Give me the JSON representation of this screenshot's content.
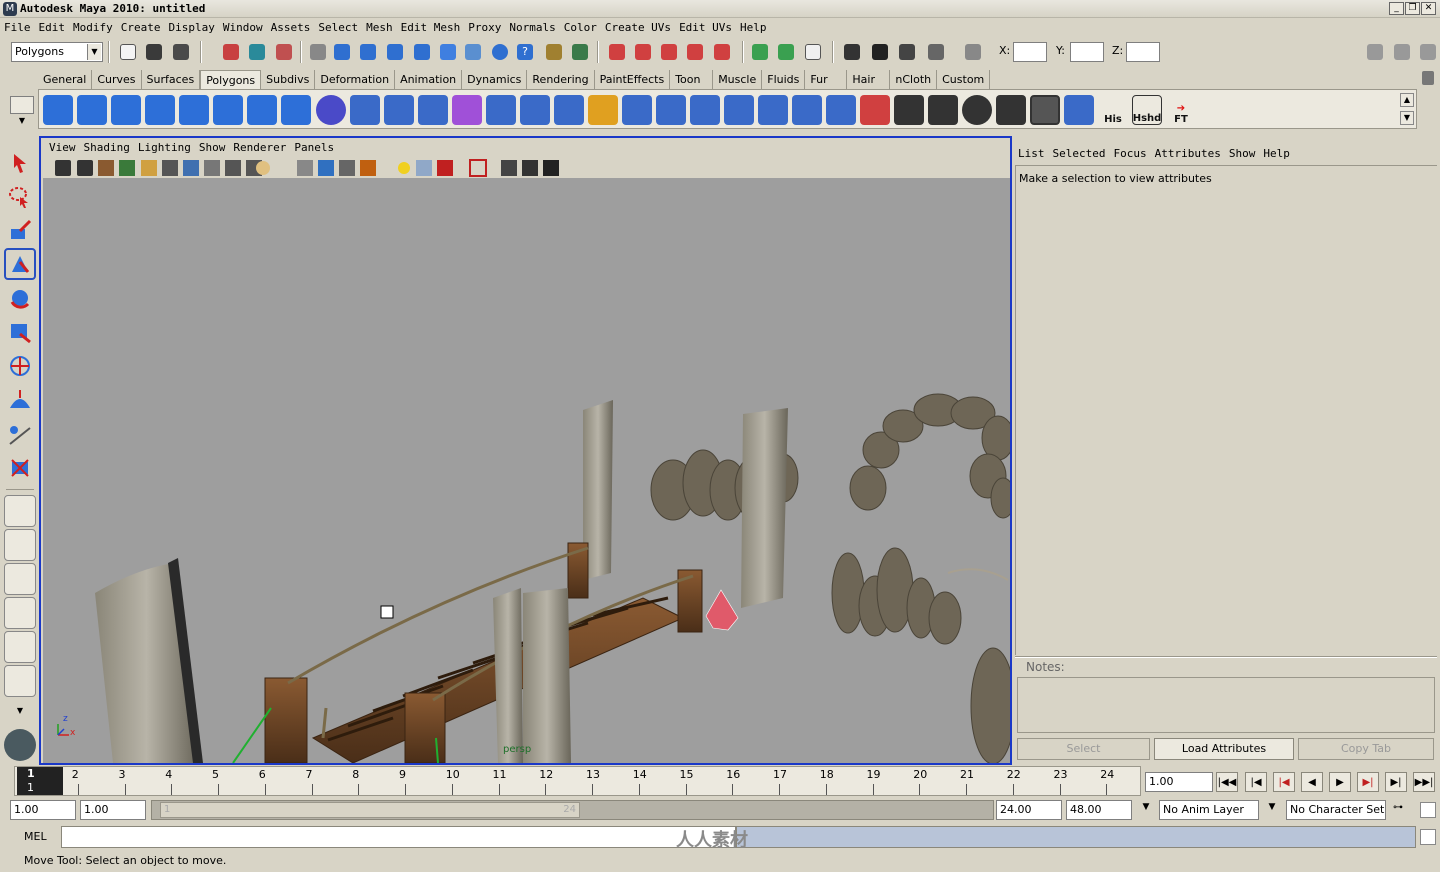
{
  "window": {
    "title": "Autodesk Maya 2010: untitled",
    "icon": "maya-icon",
    "controls": [
      "minimize-icon",
      "restore-icon",
      "close-icon"
    ]
  },
  "menubar": [
    "File",
    "Edit",
    "Modify",
    "Create",
    "Display",
    "Window",
    "Assets",
    "Select",
    "Mesh",
    "Edit Mesh",
    "Proxy",
    "Normals",
    "Color",
    "Create UVs",
    "Edit UVs",
    "Help"
  ],
  "statusline": {
    "menu_set": "Polygons",
    "x_label": "X:",
    "y_label": "Y:",
    "z_label": "Z:",
    "x_value": "",
    "y_value": "",
    "z_value": ""
  },
  "shelf": {
    "tabs": [
      "General",
      "Curves",
      "Surfaces",
      "Polygons",
      "Subdivs",
      "Deformation",
      "Animation",
      "Dynamics",
      "Rendering",
      "PaintEffects",
      "Toon",
      "Muscle",
      "Fluids",
      "Fur",
      "Hair",
      "nCloth",
      "Custom"
    ],
    "active_tab": "Polygons",
    "text_buttons": {
      "his": "His",
      "hshd": "Hshd",
      "ft": "FT"
    }
  },
  "viewport": {
    "menu": [
      "View",
      "Shading",
      "Lighting",
      "Show",
      "Renderer",
      "Panels"
    ],
    "camera_label": "persp",
    "axis_x": "x",
    "axis_z": "z"
  },
  "attribute_editor": {
    "menu": [
      "List",
      "Selected",
      "Focus",
      "Attributes",
      "Show",
      "Help"
    ],
    "message": "Make a selection to view attributes",
    "notes_label": "Notes:",
    "notes_value": "",
    "buttons": {
      "select": "Select",
      "load": "Load Attributes",
      "copy": "Copy Tab"
    }
  },
  "timeslider": {
    "ticks": [
      "1",
      "2",
      "3",
      "4",
      "5",
      "6",
      "7",
      "8",
      "9",
      "10",
      "11",
      "12",
      "13",
      "14",
      "15",
      "16",
      "17",
      "18",
      "19",
      "20",
      "21",
      "22",
      "23",
      "24"
    ],
    "current_frame": "1",
    "current_time_field": "1.00"
  },
  "rangeslider": {
    "start_time": "1.00",
    "playback_start": "1.00",
    "range_start_label": "1",
    "range_end_label": "24",
    "playback_end": "24.00",
    "end_time": "48.00",
    "anim_layer": "No Anim Layer",
    "character_set": "No Character Set"
  },
  "commandline": {
    "label": "MEL",
    "value": "",
    "watermark": "人人素材"
  },
  "helpline": "Move Tool: Select an object to move."
}
